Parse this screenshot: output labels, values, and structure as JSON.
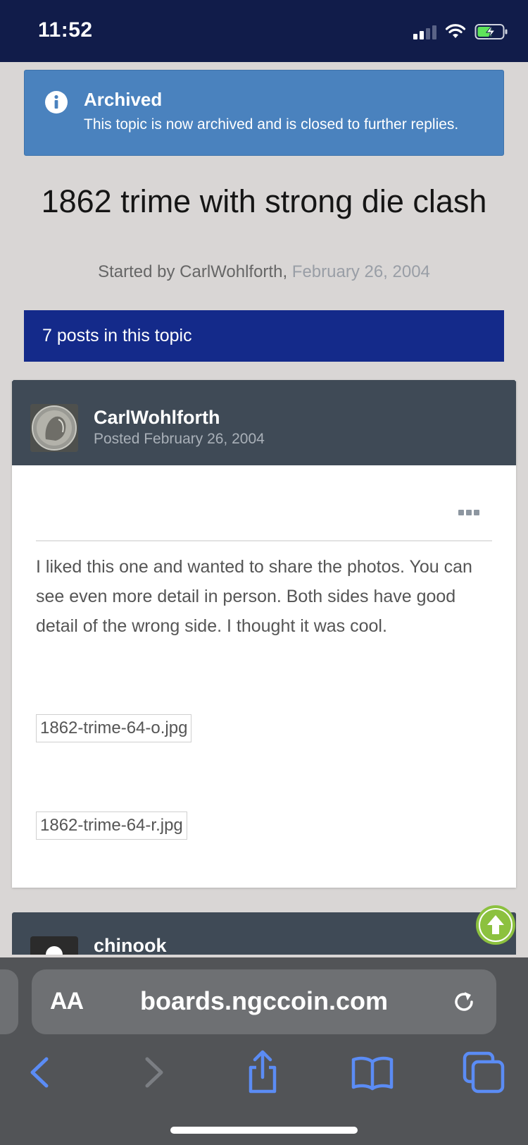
{
  "status_bar": {
    "time": "11:52"
  },
  "archived": {
    "title": "Archived",
    "text": "This topic is now archived and is closed to further replies."
  },
  "topic": {
    "title": "1862 trime with strong die clash",
    "started_by_prefix": "Started by ",
    "author": "CarlWohlforth",
    "separator": ",",
    "date": "February 26, 2004"
  },
  "posts_bar": {
    "label": "7 posts in this topic"
  },
  "post": {
    "author": "CarlWohlforth",
    "posted": "Posted February 26, 2004",
    "text": "I liked this one and wanted to share the photos. You can see even more detail in person. Both sides have good detail of the wrong side. I thought it was cool.",
    "attachments": [
      "1862-trime-64-o.jpg",
      "1862-trime-64-r.jpg"
    ]
  },
  "next_post": {
    "author": "chinook"
  },
  "browser": {
    "text_size_label": "AA",
    "url": "boards.ngccoin.com"
  },
  "colors": {
    "status_bar": "#111c4a",
    "archived_bg": "#4a82be",
    "posts_bar": "#142a8a",
    "post_header": "#3f4a56",
    "scroll_top_accent": "#8cc13f",
    "browser_icon": "#5b8cf5"
  }
}
